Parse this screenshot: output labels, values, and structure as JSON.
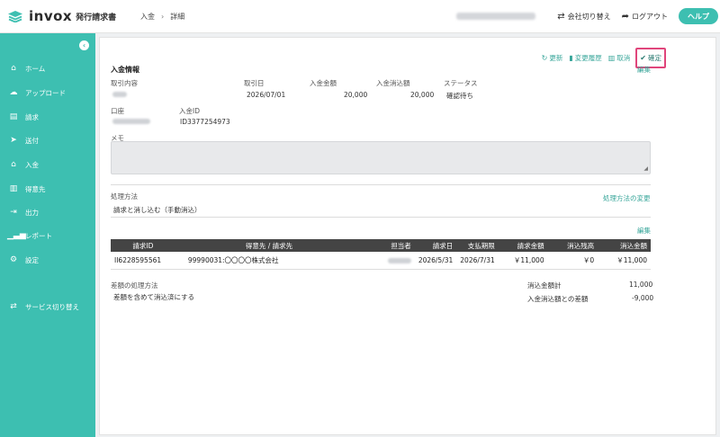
{
  "header": {
    "brand": "invox",
    "brand_sub": "発行請求書",
    "breadcrumb": [
      "入金",
      "詳細"
    ],
    "breadcrumb_sep": "›",
    "switch_company": "会社切り替え",
    "logout": "ログアウト",
    "help": "ヘルプ"
  },
  "sidebar": {
    "items": [
      {
        "label": "ホーム",
        "icon": "home-icon"
      },
      {
        "label": "アップロード",
        "icon": "upload-cloud-icon"
      },
      {
        "label": "請求",
        "icon": "document-icon"
      },
      {
        "label": "送付",
        "icon": "send-icon"
      },
      {
        "label": "入金",
        "icon": "bank-icon"
      },
      {
        "label": "得意先",
        "icon": "building-icon"
      },
      {
        "label": "出力",
        "icon": "export-icon"
      },
      {
        "label": "レポート",
        "icon": "chart-icon"
      },
      {
        "label": "設定",
        "icon": "gear-icon"
      }
    ],
    "service_switch": "サービス切り替え"
  },
  "actions": {
    "refresh": "更新",
    "history": "変更履歴",
    "cancel": "取消",
    "confirm": "確定"
  },
  "payment": {
    "section_title": "入金情報",
    "edit": "編集",
    "labels": {
      "content": "取引内容",
      "date": "取引日",
      "amount": "入金金額",
      "reconciled": "入金消込額",
      "status": "ステータス",
      "account": "口座",
      "payment_id": "入金ID",
      "memo": "メモ"
    },
    "values": {
      "date": "2026/07/01",
      "amount": "20,000",
      "reconciled": "20,000",
      "status": "確認待ち",
      "payment_id": "ID3377254973"
    }
  },
  "processing": {
    "label": "処理方法",
    "value": "請求と消し込む（手動消込）",
    "change_link": "処理方法の変更",
    "edit": "編集"
  },
  "table": {
    "headers": [
      "請求ID",
      "得意先 / 請求先",
      "担当者",
      "請求日",
      "支払期限",
      "請求金額",
      "消込残高",
      "消込金額"
    ],
    "rows": [
      {
        "invoice_id": "II6228595561",
        "customer": "99990031:〇〇〇〇株式会社",
        "invoice_date": "2026/5/31",
        "due_date": "2026/7/31",
        "amount": "￥11,000",
        "remaining": "￥0",
        "reconciled": "￥11,000"
      }
    ]
  },
  "diff": {
    "label": "差額の処理方法",
    "value": "差額を含めて消込済にする",
    "total_label": "消込金額計",
    "total_value": "11,000",
    "diff_label": "入金消込額との差額",
    "diff_value": "-9,000"
  }
}
